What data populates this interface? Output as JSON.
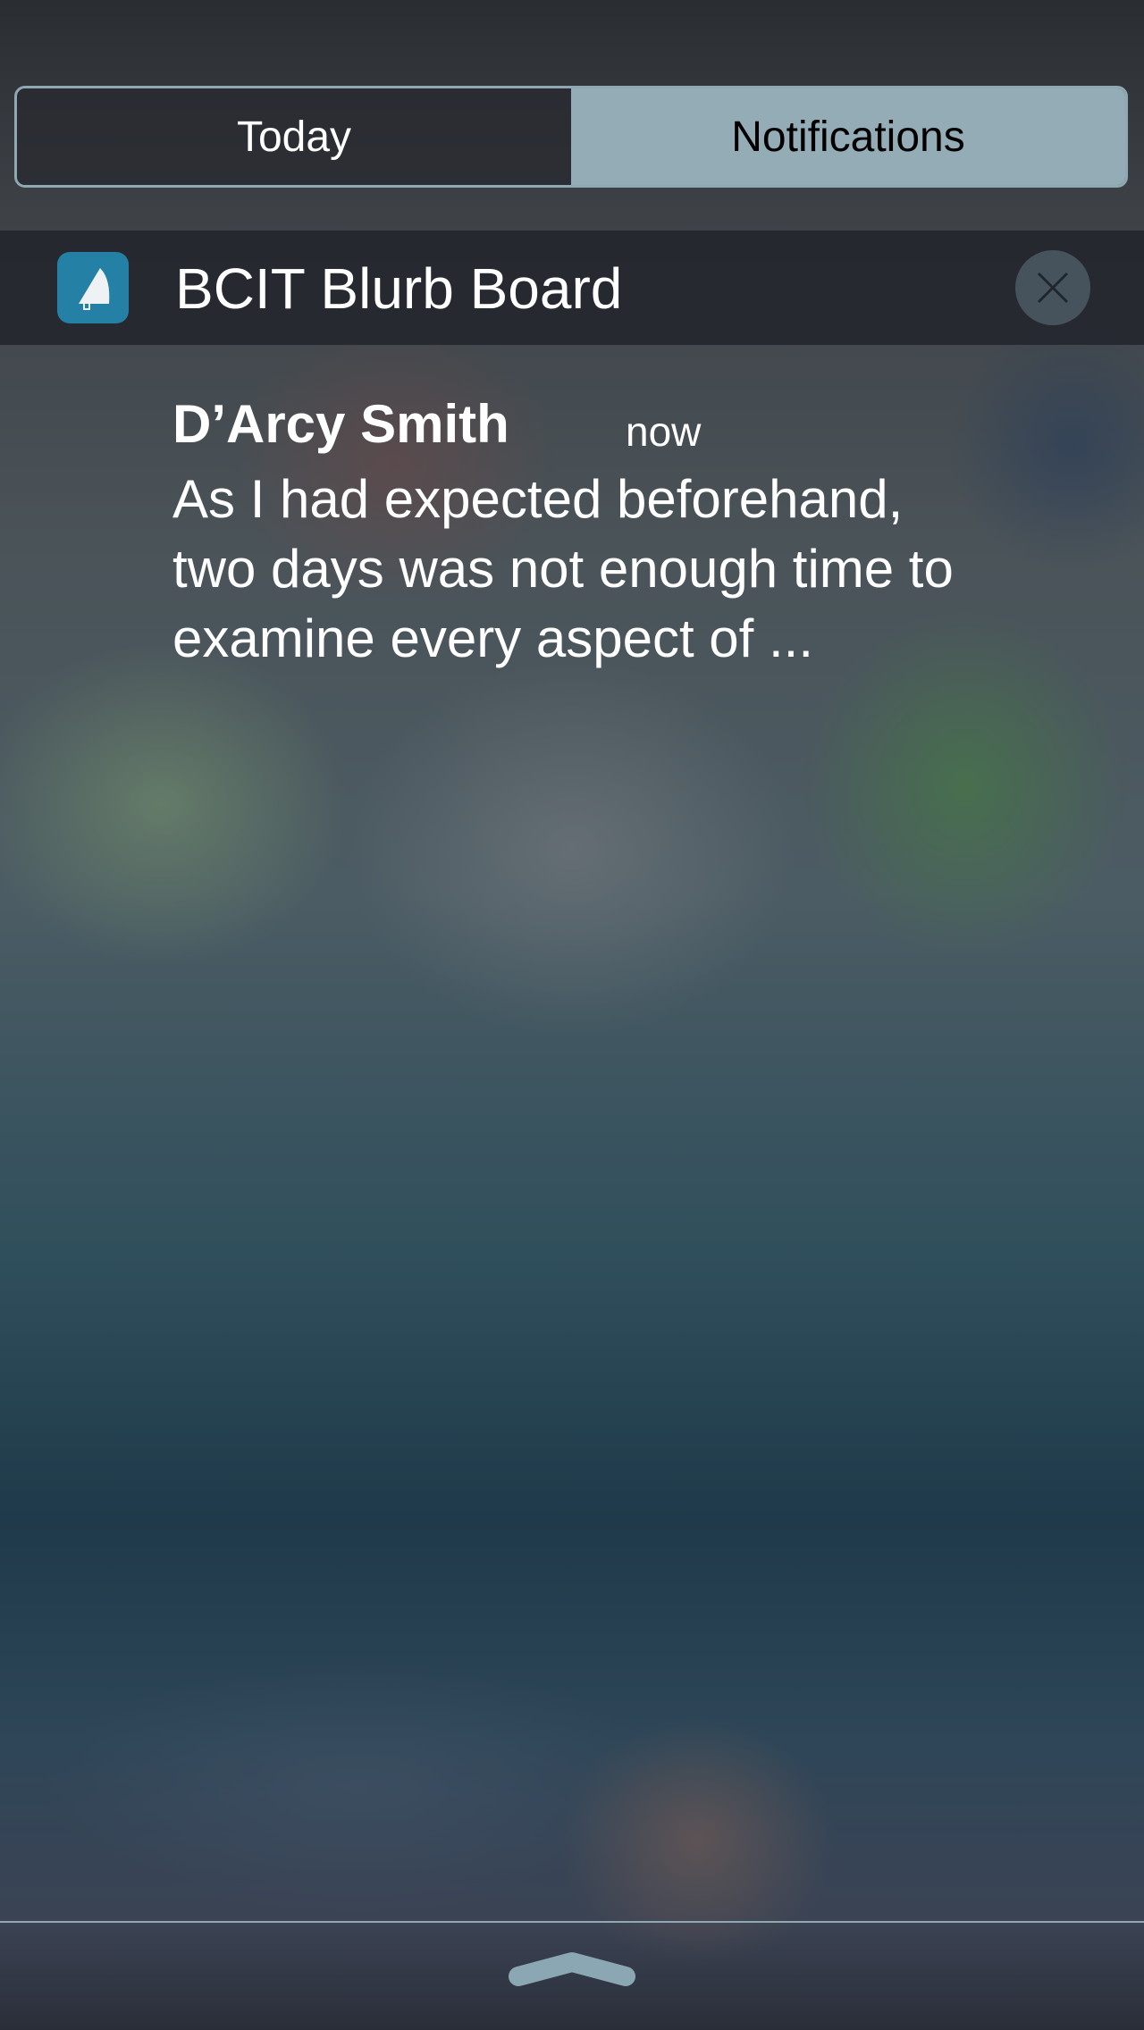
{
  "tabs": [
    {
      "label": "Today",
      "selected": false
    },
    {
      "label": "Notifications",
      "selected": true
    }
  ],
  "notification_group": {
    "app_name": "BCIT Blurb Board",
    "app_icon": "megaphone-icon",
    "app_color": "#2580a6"
  },
  "notification": {
    "sender": "D’Arcy Smith",
    "time": "now",
    "lines": [
      "As I had expected beforehand,",
      "two days was not enough time to",
      "examine every aspect of ..."
    ]
  }
}
